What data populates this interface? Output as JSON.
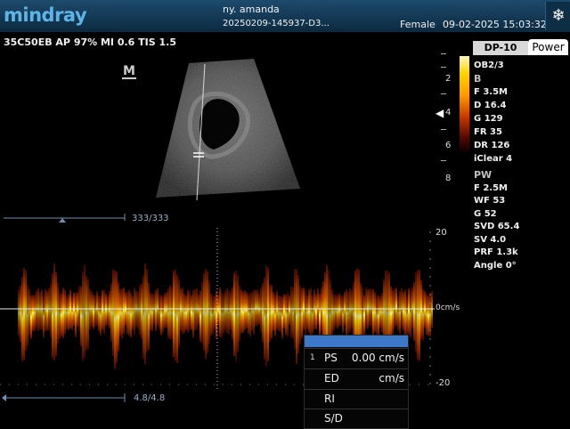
{
  "header": {
    "brand": "mindray",
    "patient_name": "ny. amanda",
    "exam_id": "20250209-145937-D3...",
    "gender": "Female",
    "datetime": "09-02-2025 15:03:32",
    "freeze_icon": "snowflake-icon",
    "freeze_glyph": "❄"
  },
  "probe": {
    "info": "35C50EB  AP 97%  MI 0.6  TIS 1.5"
  },
  "image": {
    "orientation_marker": "M"
  },
  "presets": {
    "exam_preset": "DP-10",
    "power_tab": "Power"
  },
  "b_mode": {
    "header": "B",
    "params": [
      "F 3.5M",
      "D 16.4",
      "G 129",
      "FR 35",
      "DR 126",
      "iClear 4"
    ]
  },
  "ob_label": "OB2/3",
  "pw_mode": {
    "header": "PW",
    "params": [
      "F 2.5M",
      "WF 53",
      "G 52",
      "SVD 65.4",
      "SV 4.0",
      "PRF 1.3k",
      "Angle 0°"
    ]
  },
  "depth_scale": {
    "labels": [
      "2",
      "4",
      "6",
      "8"
    ]
  },
  "doppler": {
    "scale_top": "20",
    "baseline": "0cm/s",
    "scale_bottom": "-20",
    "top_bracket": "333/333",
    "bottom_bracket": "4.8/4.8",
    "spectrum_level": 0.7
  },
  "measurements": {
    "rows": [
      {
        "index": "1",
        "label": "PS",
        "value": "0.00 cm/s"
      },
      {
        "index": "",
        "label": "ED",
        "value": "cm/s"
      },
      {
        "index": "",
        "label": "RI",
        "value": ""
      },
      {
        "index": "",
        "label": "S/D",
        "value": ""
      }
    ]
  },
  "colors": {
    "accent": "#5fb4e6",
    "header_bg": "#0c2a40",
    "calc_header": "#3b78c8",
    "spectrum_hot": "#ffd400"
  }
}
